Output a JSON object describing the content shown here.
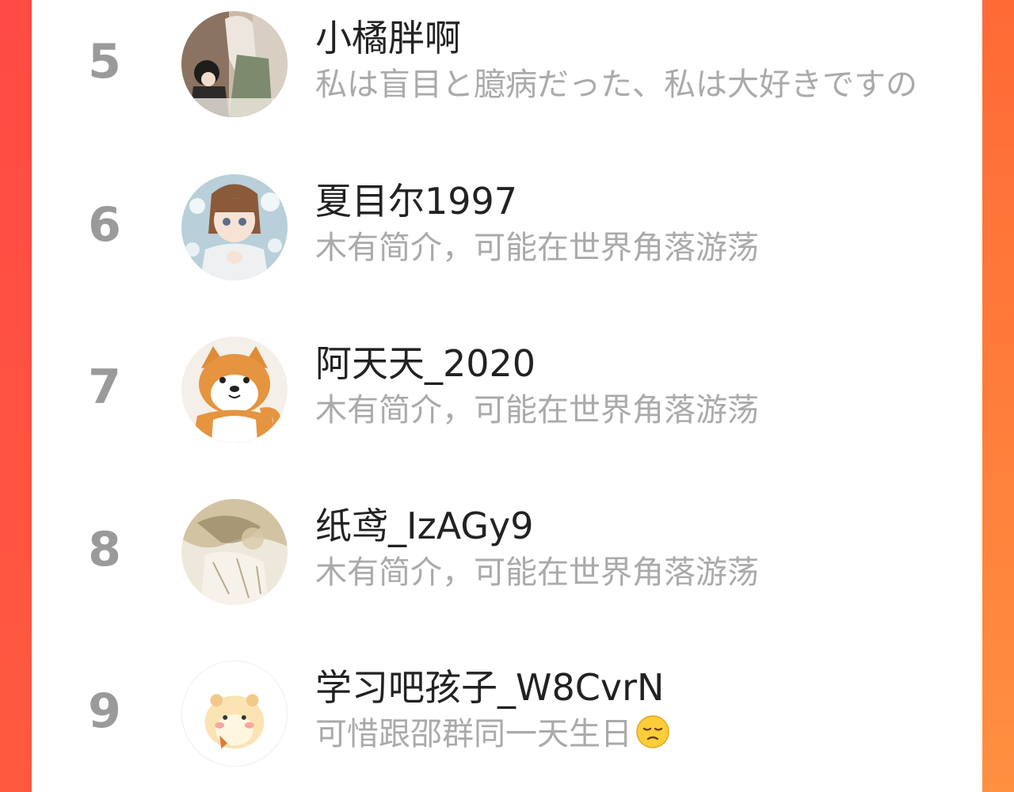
{
  "ranking": {
    "rows": [
      {
        "rank": "5",
        "name": "小橘胖啊",
        "bio": "私は盲目と臆病だった、私は大好きですの",
        "avatar_icon": "anime-couple-avatar"
      },
      {
        "rank": "6",
        "name": "夏目尔1997",
        "bio": "木有简介，可能在世界角落游荡",
        "avatar_icon": "anime-girl-flowers-avatar"
      },
      {
        "rank": "7",
        "name": "阿天天_2020",
        "bio": "木有简介，可能在世界角落游荡",
        "avatar_icon": "shiba-dog-avatar"
      },
      {
        "rank": "8",
        "name": "纸鸢_IzAGy9",
        "bio": "木有简介，可能在世界角落游荡",
        "avatar_icon": "sketch-illustration-avatar"
      },
      {
        "rank": "9",
        "name": "学习吧孩子_W8CvrN",
        "bio": "可惜跟邵群同一天生日",
        "bio_emoji": "pensive-face-emoji",
        "avatar_icon": "hamster-avatar"
      }
    ]
  },
  "colors": {
    "background_left": "#ff4a45",
    "background_right": "#ff9040",
    "rank_text": "#9a9a9a",
    "name_text": "#222222",
    "bio_text": "#aaaaaa"
  }
}
